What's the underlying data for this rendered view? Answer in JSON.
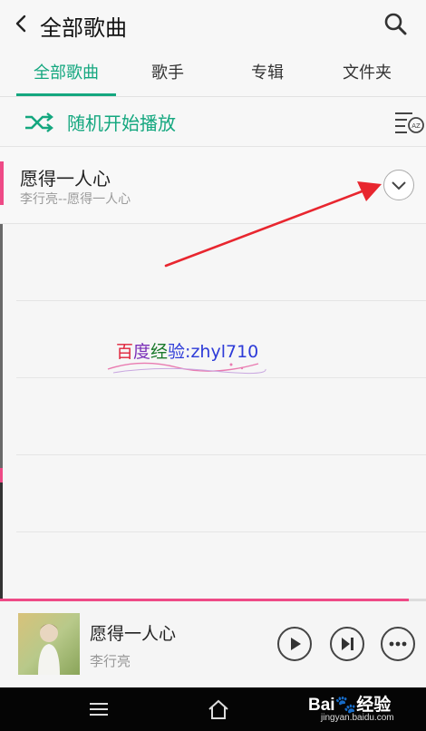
{
  "header": {
    "title": "全部歌曲"
  },
  "tabs": [
    {
      "label": "全部歌曲",
      "active": true
    },
    {
      "label": "歌手",
      "active": false
    },
    {
      "label": "专辑",
      "active": false
    },
    {
      "label": "文件夹",
      "active": false
    }
  ],
  "shuffle": {
    "label": "随机开始播放"
  },
  "songs": [
    {
      "title": "愿得一人心",
      "subtitle": "李行亮--愿得一人心"
    }
  ],
  "watermark": {
    "part1": "百",
    "part2": "度",
    "part3": "经",
    "part4": "验:zhyl710"
  },
  "player": {
    "title": "愿得一人心",
    "artist": "李行亮",
    "progress": 0.96
  },
  "footer": {
    "brand": "Bai",
    "brand2": "经验",
    "url": "jingyan.baidu.com"
  },
  "colors": {
    "accent": "#14a77f",
    "highlight": "#ee4a86"
  },
  "icons": [
    "back-icon",
    "search-icon",
    "shuffle-icon",
    "sort-az-icon",
    "chevron-down-icon",
    "play-icon",
    "next-icon",
    "more-icon",
    "menu-icon",
    "home-icon"
  ]
}
